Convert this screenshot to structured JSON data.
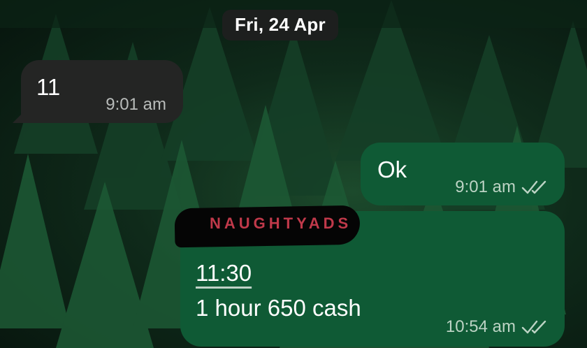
{
  "date_separator": "Fri, 24 Apr",
  "messages": [
    {
      "direction": "incoming",
      "text": "11",
      "time": "9:01 am"
    },
    {
      "direction": "outgoing",
      "text": "Ok",
      "time": "9:01 am",
      "status_icon": "double-check-icon"
    },
    {
      "direction": "outgoing",
      "link_text": "11:30",
      "text": "1 hour 650 cash",
      "time": "10:54 am",
      "status_icon": "double-check-icon"
    }
  ],
  "watermark": "NAUGHTYADS",
  "colors": {
    "incoming_bubble": "#242524",
    "outgoing_bubble": "#0f5a35",
    "date_pill": "#1d1f1e",
    "watermark": "#c0394a"
  }
}
